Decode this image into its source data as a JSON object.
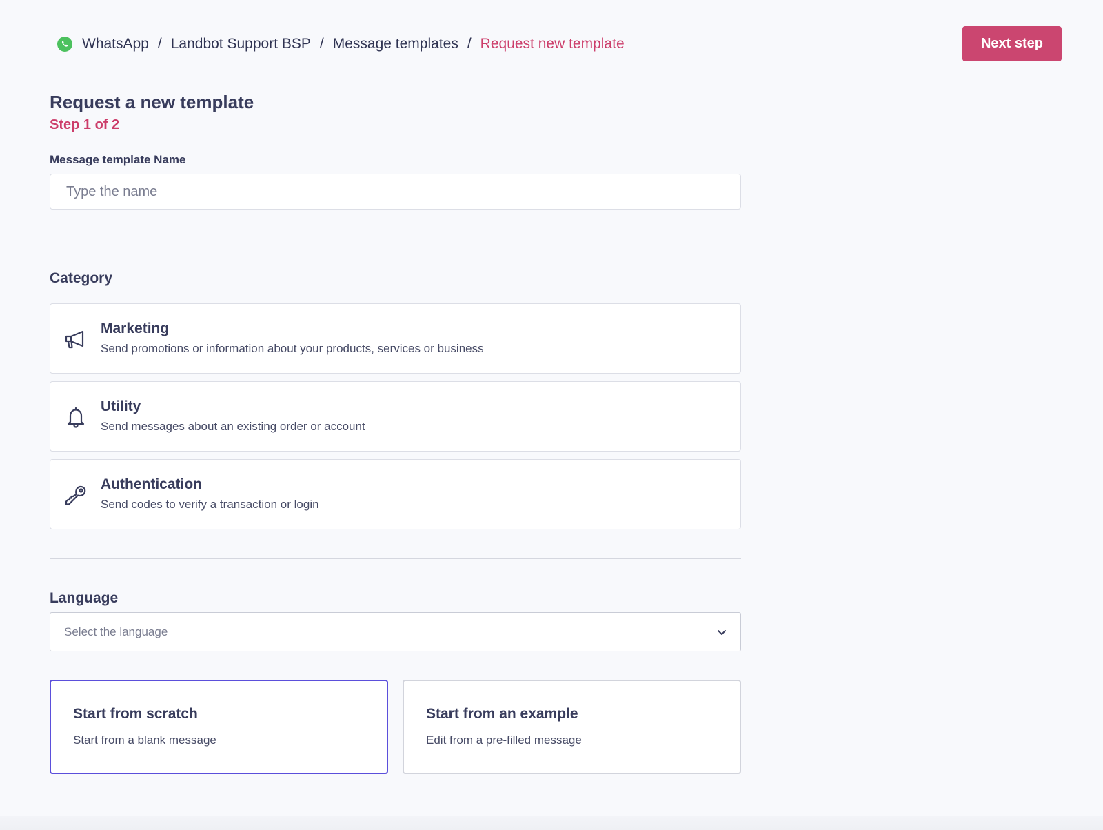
{
  "breadcrumb": {
    "items": [
      "WhatsApp",
      "Landbot Support BSP",
      "Message templates",
      "Request new template"
    ],
    "separator": "/"
  },
  "header": {
    "next_step_label": "Next step"
  },
  "page": {
    "title": "Request a new template",
    "step": "Step 1 of 2"
  },
  "name_field": {
    "label": "Message template Name",
    "placeholder": "Type the name",
    "value": ""
  },
  "category": {
    "title": "Category",
    "options": [
      {
        "name": "Marketing",
        "description": "Send promotions or information about your products, services or business",
        "icon": "megaphone-icon"
      },
      {
        "name": "Utility",
        "description": "Send messages about an existing order or account",
        "icon": "bell-icon"
      },
      {
        "name": "Authentication",
        "description": "Send codes to verify a transaction or login",
        "icon": "key-icon"
      }
    ]
  },
  "language": {
    "title": "Language",
    "placeholder": "Select the language"
  },
  "start_options": [
    {
      "title": "Start from scratch",
      "description": "Start from a blank message",
      "selected": true
    },
    {
      "title": "Start from an example",
      "description": "Edit from a pre-filled message",
      "selected": false
    }
  ],
  "colors": {
    "accent": "#cb4670",
    "selected_border": "#5b4fdb",
    "text": "#383c5c",
    "whatsapp_green": "#4cc15e"
  }
}
